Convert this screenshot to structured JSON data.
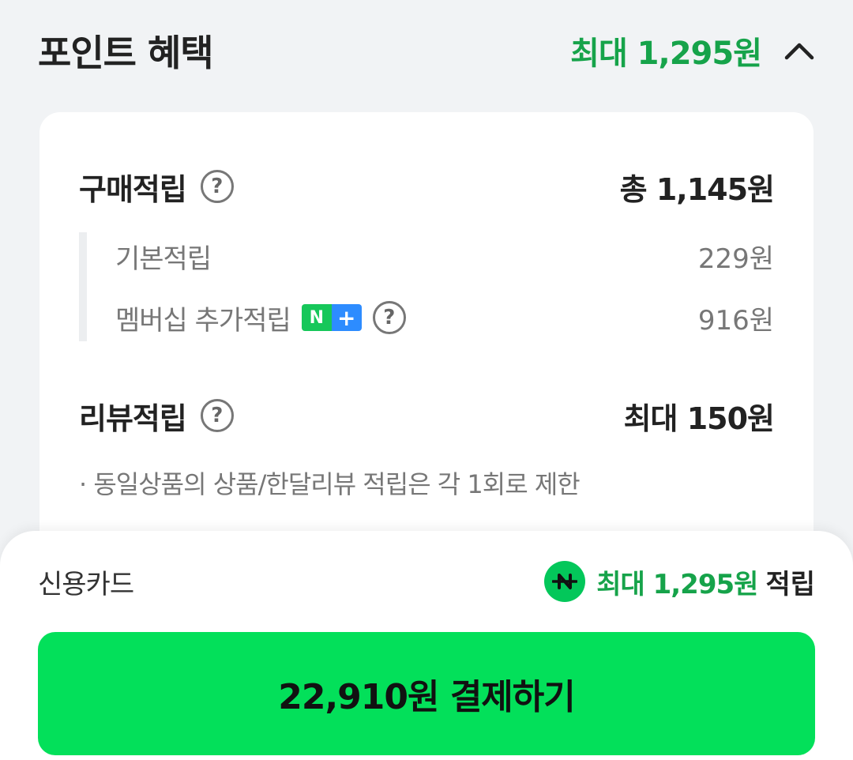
{
  "header": {
    "title": "포인트 혜택",
    "max_benefit": "최대 1,295원"
  },
  "purchase": {
    "label": "구매적립",
    "total": "총 1,145원",
    "basic_label": "기본적립",
    "basic_value": "229원",
    "membership_label": "멤버십 추가적립",
    "membership_badge_n": "N",
    "membership_badge_plus": "+",
    "membership_value": "916원"
  },
  "review": {
    "label": "리뷰적립",
    "value": "최대 150원",
    "note": "· 동일상품의 상품/한달리뷰 적립은 각 1회로 제한"
  },
  "bottom": {
    "method": "신용카드",
    "max": "최대 1,295원",
    "accum": "적립",
    "pay_button": "22,910원 결제하기"
  },
  "help_glyph": "?",
  "colors": {
    "accent_green": "#16a34a",
    "button_green": "#03e05a",
    "npay_green": "#03c75a",
    "nplus_blue": "#2d8cff"
  }
}
